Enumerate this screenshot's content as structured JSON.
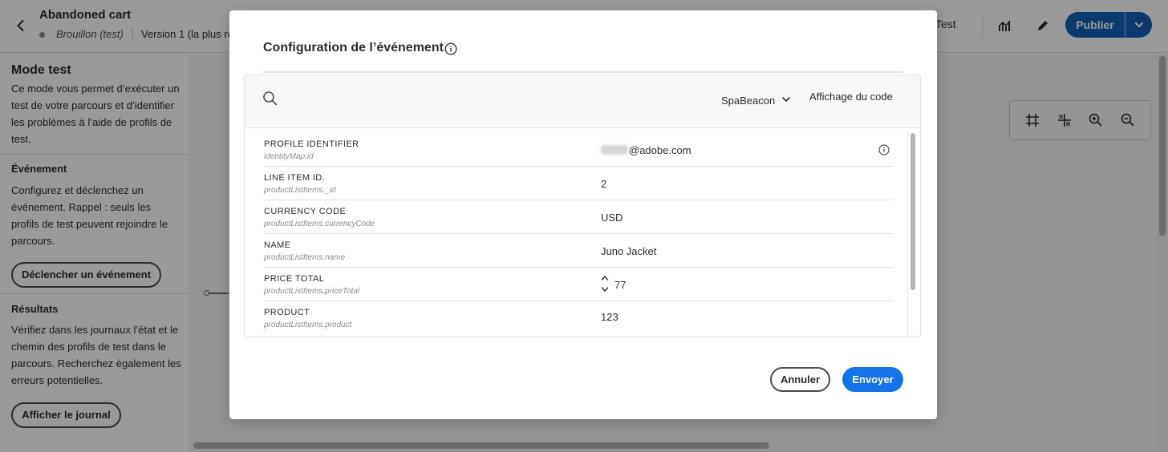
{
  "header": {
    "title": "Abandoned cart",
    "status": "Brouillon (test)",
    "version": "Version 1 (la plus ré",
    "test_label": "Test",
    "publish_label": "Publier"
  },
  "left_panel": {
    "title": "Mode test",
    "intro": "Ce mode vous permet d’exécuter un test de votre parcours et d’identifier les problèmes à l’aide de profils de test.",
    "event_heading": "Événement",
    "event_text": "Configurez et déclenchez un événement. Rappel : seuls les profils de test peuvent rejoindre le parcours.",
    "event_button": "Déclencher un événement",
    "results_heading": "Résultats",
    "results_text": "Vérifiez dans les journaux l’état et le chemin des profils de test dans le parcours. Recherchez également les erreurs potentielles.",
    "results_button": "Afficher le journal"
  },
  "modal": {
    "title": "Configuration de l’événement",
    "event_select": "SpaBeacon",
    "code_view_label": "Affichage du code",
    "fields": [
      {
        "label": "PROFILE IDENTIFIER",
        "path": "identityMap.id",
        "value": "@adobe.com"
      },
      {
        "label": "LINE ITEM ID.",
        "path": "productListItems._id",
        "value": "2"
      },
      {
        "label": "CURRENCY CODE",
        "path": "productListItems.currencyCode",
        "value": "USD"
      },
      {
        "label": "NAME",
        "path": "productListItems.name",
        "value": "Juno Jacket"
      },
      {
        "label": "PRICE TOTAL",
        "path": "productListItems.priceTotal",
        "value": "77"
      },
      {
        "label": "PRODUCT",
        "path": "productListItems.product",
        "value": "123"
      }
    ],
    "cancel_label": "Annuler",
    "send_label": "Envoyer"
  },
  "colors": {
    "primary_blue": "#1473e6",
    "publish_blue": "#1462b8",
    "text": "#2c2c2c",
    "overlay": "rgba(0,0,0,0.4)"
  },
  "icons": {
    "back": "chevron-left-icon",
    "analytics": "analytics-icon",
    "edit": "pencil-icon",
    "publish_menu": "chevron-down-icon",
    "grid": "grid-icon",
    "align": "align-icon",
    "zoom_in": "zoom-in-icon",
    "zoom_out": "zoom-out-icon",
    "info": "info-icon",
    "search": "search-icon",
    "stepper": "stepper-icon"
  }
}
